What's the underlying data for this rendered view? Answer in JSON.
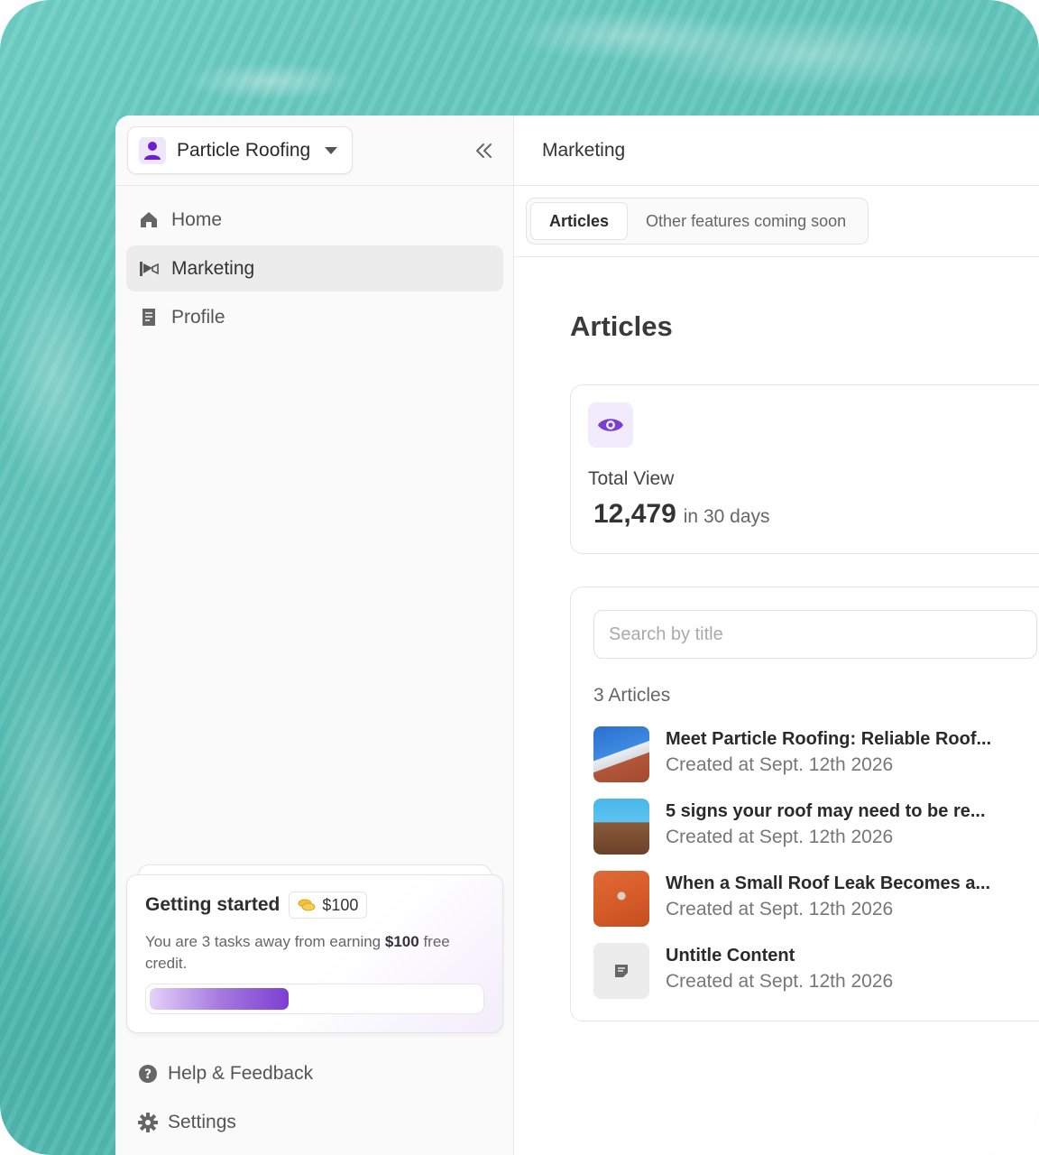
{
  "sidebar": {
    "org_name": "Particle Roofing",
    "nav": [
      {
        "label": "Home",
        "icon": "home-icon"
      },
      {
        "label": "Marketing",
        "icon": "megaphone-icon",
        "active": true
      },
      {
        "label": "Profile",
        "icon": "document-icon"
      }
    ],
    "getting_started": {
      "title": "Getting started",
      "badge": "$100",
      "desc_prefix": "You are 3 tasks away from earning",
      "desc_amount": "$100",
      "desc_suffix": "free credit.",
      "progress": 0.42
    },
    "bottom": [
      {
        "label": "Help & Feedback",
        "icon": "help-icon"
      },
      {
        "label": "Settings",
        "icon": "gear-icon"
      }
    ]
  },
  "main": {
    "title": "Marketing",
    "tabs": [
      {
        "label": "Articles",
        "active": true
      },
      {
        "label": "Other features coming soon"
      }
    ],
    "heading": "Articles",
    "stat": {
      "label": "Total View",
      "value": "12,479",
      "period": "in 30 days"
    },
    "search_placeholder": "Search by title",
    "count_label": "3 Articles",
    "articles": [
      {
        "title": "Meet Particle Roofing: Reliable Roof...",
        "date": "Created at Sept. 12th 2026"
      },
      {
        "title": "5 signs your roof may need to be re...",
        "date": "Created at Sept. 12th 2026"
      },
      {
        "title": "When a Small Roof Leak Becomes a...",
        "date": "Created at Sept. 12th 2026"
      },
      {
        "title": "Untitle Content",
        "date": "Created at Sept. 12th 2026"
      }
    ]
  },
  "colors": {
    "accent": "#7c3fd1",
    "water": "#5cc2b8"
  }
}
